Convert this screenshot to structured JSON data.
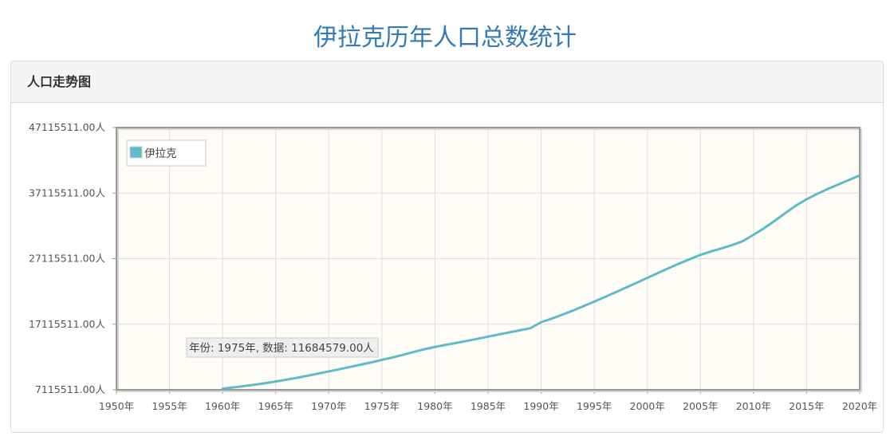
{
  "page": {
    "title": "伊拉克历年人口总数统计"
  },
  "panel": {
    "heading": "人口走势图"
  },
  "tooltip": {
    "text": "年份: 1975年, 数据: 11684579.00人"
  },
  "colors": {
    "series": "#5fbacd",
    "plot_background": "#fffdf6",
    "title": "#337ab7",
    "grid": "#dddddd"
  },
  "chart_data": {
    "type": "line",
    "xlim": [
      1950,
      2020
    ],
    "ylim": [
      7115511,
      47115511
    ],
    "x_ticks": [
      1950,
      1955,
      1960,
      1965,
      1970,
      1975,
      1980,
      1985,
      1990,
      1995,
      2000,
      2005,
      2010,
      2015,
      2020
    ],
    "x_tick_labels": [
      "1950年",
      "1955年",
      "1960年",
      "1965年",
      "1970年",
      "1975年",
      "1980年",
      "1985年",
      "1990年",
      "1995年",
      "2000年",
      "2005年",
      "2010年",
      "2015年",
      "2020年"
    ],
    "y_ticks": [
      7115511,
      17115511,
      27115511,
      37115511,
      47115511
    ],
    "y_tick_labels": [
      "7115511.00人",
      "17115511.00人",
      "27115511.00人",
      "37115511.00人",
      "47115511.00人"
    ],
    "grid": true,
    "legend_position": "top-left",
    "series": [
      {
        "name": "伊拉克",
        "x": [
          1960,
          1961,
          1962,
          1963,
          1964,
          1965,
          1966,
          1967,
          1968,
          1969,
          1970,
          1971,
          1972,
          1973,
          1974,
          1975,
          1976,
          1977,
          1978,
          1979,
          1980,
          1981,
          1982,
          1983,
          1984,
          1985,
          1986,
          1987,
          1988,
          1989,
          1990,
          1991,
          1992,
          1993,
          1994,
          1995,
          1996,
          1997,
          1998,
          1999,
          2000,
          2001,
          2002,
          2003,
          2004,
          2005,
          2006,
          2007,
          2008,
          2009,
          2010,
          2011,
          2012,
          2013,
          2014,
          2015,
          2016,
          2017,
          2018,
          2019,
          2020
        ],
        "y": [
          7289761,
          7475352,
          7674223,
          7888914,
          8122131,
          8375793,
          8651362,
          8947439,
          9260684,
          9585576,
          9917983,
          10255907,
          10599265,
          10944418,
          11292098,
          11684579,
          12041150,
          12455510,
          12877320,
          13303630,
          13653359,
          13967400,
          14262000,
          14568000,
          14887000,
          15223000,
          15547000,
          15869000,
          16186000,
          16514000,
          17419000,
          17975000,
          18572000,
          19207000,
          19876000,
          20568000,
          21270000,
          21980000,
          22703000,
          23439000,
          24186000,
          24923000,
          25656000,
          26365000,
          27046000,
          27683000,
          28217000,
          28693000,
          29188000,
          29797000,
          30762000,
          31761000,
          32890000,
          34085000,
          35217000,
          36179000,
          37000000,
          37748000,
          38433000,
          39121000,
          39818000
        ]
      }
    ]
  }
}
